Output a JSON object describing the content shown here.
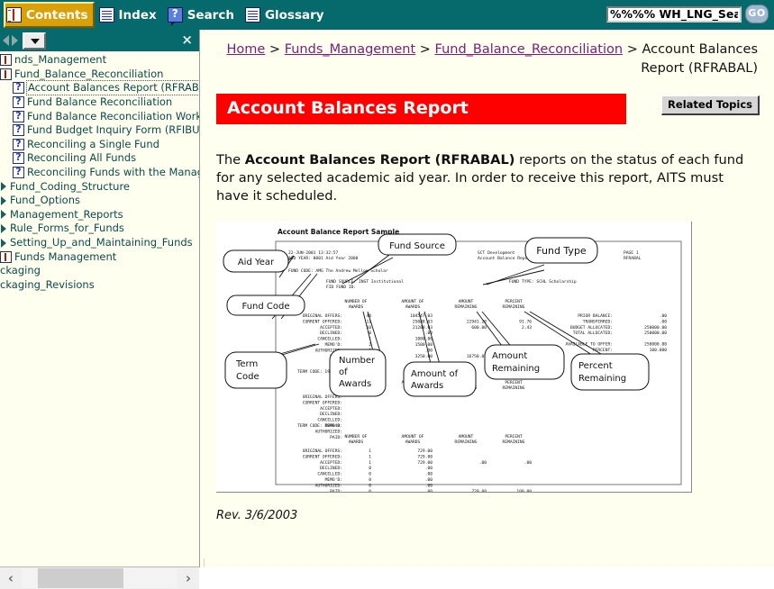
{
  "toolbar": {
    "items": [
      {
        "label": "Contents",
        "icon": "book-icon",
        "active": true
      },
      {
        "label": "Index",
        "icon": "document-icon",
        "active": false
      },
      {
        "label": "Search",
        "icon": "question-balloon-icon",
        "active": false
      },
      {
        "label": "Glossary",
        "icon": "document-icon",
        "active": false
      }
    ],
    "search_value": "%%%% WH_LNG_SearchI",
    "search_placeholder": "",
    "go_label": "GO"
  },
  "nav": {
    "back_icon": "triangle-left-icon",
    "forward_icon": "triangle-right-icon",
    "dropdown_icon": "chevron-down-icon",
    "close_icon": "close-icon",
    "close_label": "×",
    "tree": [
      {
        "label": "nds_Management",
        "icon": "book-icon",
        "indent": 0,
        "selected": false
      },
      {
        "label": "Fund_Balance_Reconciliation",
        "icon": "book-icon",
        "indent": 0,
        "selected": false
      },
      {
        "label": "Account Balances Report (RFRABAL)",
        "icon": "topic-icon",
        "indent": 1,
        "selected": true
      },
      {
        "label": "Fund Balance Reconciliation",
        "icon": "topic-icon",
        "indent": 1,
        "selected": false
      },
      {
        "label": "Fund Balance Reconciliation Workflow",
        "icon": "topic-icon",
        "indent": 1,
        "selected": false
      },
      {
        "label": "Fund Budget Inquiry Form (RFIBUDG)",
        "icon": "topic-icon",
        "indent": 1,
        "selected": false
      },
      {
        "label": "Reconciling a Single Fund",
        "icon": "topic-icon",
        "indent": 1,
        "selected": false
      },
      {
        "label": "Reconciling All Funds",
        "icon": "topic-icon",
        "indent": 1,
        "selected": false
      },
      {
        "label": "Reconciling Funds with the Management",
        "icon": "topic-icon",
        "indent": 1,
        "selected": false
      },
      {
        "label": "Fund_Coding_Structure",
        "icon": "arrow-icon",
        "indent": 0,
        "selected": false
      },
      {
        "label": "Fund_Options",
        "icon": "arrow-icon",
        "indent": 0,
        "selected": false
      },
      {
        "label": "Management_Reports",
        "icon": "arrow-icon",
        "indent": 0,
        "selected": false
      },
      {
        "label": "Rule_Forms_for_Funds",
        "icon": "arrow-icon",
        "indent": 0,
        "selected": false
      },
      {
        "label": "Setting_Up_and_Maintaining_Funds",
        "icon": "arrow-icon",
        "indent": 0,
        "selected": false
      },
      {
        "label": "Funds Management",
        "icon": "book-icon",
        "indent": 0,
        "selected": false
      },
      {
        "label": "ckaging",
        "icon": "none",
        "indent": 0,
        "selected": false
      },
      {
        "label": "ckaging_Revisions",
        "icon": "none",
        "indent": 0,
        "selected": false
      }
    ],
    "scroll_left_label": "‹",
    "scroll_right_label": "›"
  },
  "breadcrumb": {
    "items": [
      {
        "label": "Home",
        "link": true
      },
      {
        "label": "Funds_Management",
        "link": true
      },
      {
        "label": "Fund_Balance_Reconciliation",
        "link": true
      },
      {
        "label": "Account Balances Report (RFRABAL)",
        "link": false
      }
    ],
    "separator": ">"
  },
  "page": {
    "title": "Account Balances Report",
    "related_topics_label": "Related Topics",
    "body_prefix": "The ",
    "body_bold": "Account Balances Report (RFRABAL)",
    "body_suffix": " reports on the status of each fund for any selected academic aid year. In order to receive this report, AITS must have it scheduled.",
    "revision": "Rev. 3/6/2003"
  },
  "figure": {
    "caption": "Account Balance Report Sample",
    "callouts": [
      {
        "name": "aid-year",
        "label": "Aid Year"
      },
      {
        "name": "fund-code",
        "label": "Fund Code"
      },
      {
        "name": "fund-source",
        "label": "Fund Source"
      },
      {
        "name": "fund-type",
        "label": "Fund Type"
      },
      {
        "name": "term-code",
        "label": "Term Code"
      },
      {
        "name": "number-of-awards",
        "label": "Number of Awards"
      },
      {
        "name": "amount-of-awards",
        "label": "Amount of Awards"
      },
      {
        "name": "amount-remaining",
        "label": "Amount Remaining"
      },
      {
        "name": "percent-remaining",
        "label": "Percent Remaining"
      }
    ],
    "report": {
      "run_date": "22-JUN-2001 13:32:57",
      "aid_year": "AID YEAR: 0001 Aid Year 2000",
      "org_line1": "SCT Development",
      "org_line2": "Account Balance Report",
      "page_line1": "PAGE 1",
      "page_line2": "RFRABAL",
      "fund_code": "FUND CODE: AMG The Andrew Mellon Scholar",
      "fund_source": "FUND SOURCE: INST Institutional",
      "fid_fund_id": "FID FUND ID:",
      "fund_type": "FUND TYPE: SCHL Scholarship",
      "col_headers": [
        [
          "NUMBER OF",
          "AWARDS"
        ],
        [
          "AMOUNT OF",
          "AWARDS"
        ],
        [
          "AMOUNT",
          "REMAINING"
        ],
        [
          "PERCENT",
          "REMAINING"
        ]
      ],
      "row_labels": [
        "ORIGINAL OFFERS:",
        "CURRENT OFFERED:",
        "ACCEPTED:",
        "DECLINED:",
        "CANCELLED:",
        "MEMO'D:",
        "AUTHORIZED:",
        "PAID:"
      ],
      "summary_labels": [
        "PRIOR BALANCE:",
        "TRANSFERRED:",
        "BUDGET ALLOCATED:",
        "TOTAL ALLOCATED:",
        "AVAILABLE TO OFFER:",
        "PERCENT:"
      ],
      "summary_values": [
        ".00",
        ".00",
        "250000.00",
        "250000.00",
        "250000.00",
        "100.000"
      ],
      "fund_block": {
        "num_awards": [
          "40",
          "11",
          "10",
          "0",
          "1",
          "2",
          "0",
          "2"
        ],
        "amt_awards": [
          "104547.03",
          "25088.03",
          "21208.03",
          ".00",
          "1080.00",
          "1500.00",
          ".00",
          "3250.00"
        ],
        "amt_remaining": [
          "",
          "22941.20",
          "600.00",
          "",
          "",
          "",
          "",
          "16750.00"
        ],
        "pct_remaining": [
          "",
          "91.76",
          "2.43",
          "",
          "",
          "",
          "",
          ""
        ]
      },
      "term_block_1_code": "TERM CODE: 199940",
      "term_block_2_code": "TERM CODE: 199940",
      "term_block_2": {
        "num_awards": [
          "1",
          "1",
          "1",
          "0",
          "0",
          "0",
          "0",
          "0"
        ],
        "amt_awards": [
          "729.00",
          "729.00",
          "729.00",
          ".00",
          ".00",
          ".00",
          ".00",
          ".00"
        ],
        "amt_remaining": [
          "",
          "",
          ".00",
          "",
          "",
          "",
          "",
          "729.00"
        ],
        "pct_remaining": [
          "",
          "",
          ".00",
          "",
          "",
          "",
          "",
          "100.00"
        ]
      }
    }
  },
  "colors": {
    "teal": "#06696b",
    "gold": "#d9a008",
    "red": "#fe0000",
    "cream": "#fffff0",
    "link": "#7a1d7a",
    "tree_text": "#0b4a4a"
  }
}
